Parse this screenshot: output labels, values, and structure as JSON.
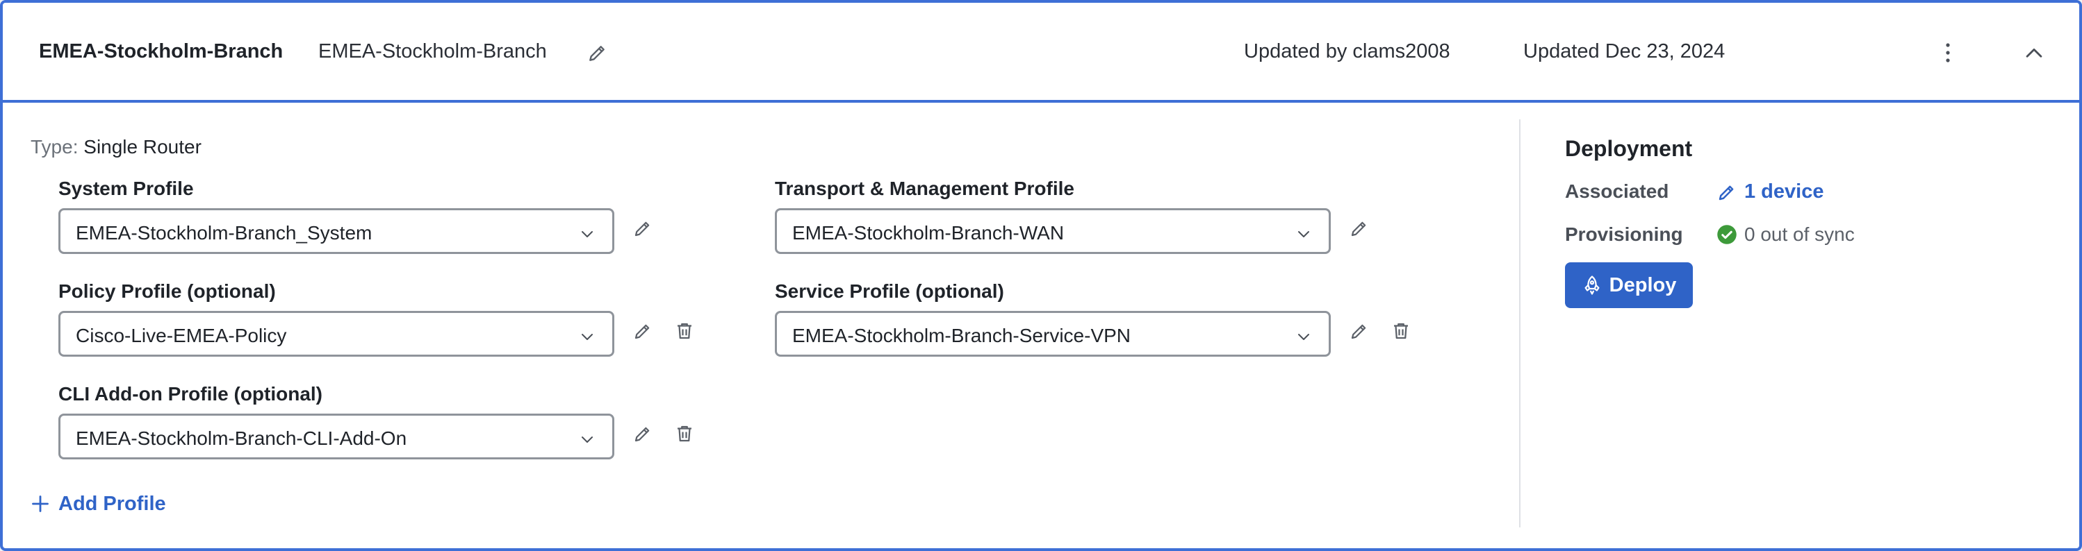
{
  "header": {
    "name": "EMEA-Stockholm-Branch",
    "description": "EMEA-Stockholm-Branch",
    "updated_by": "Updated by clams2008",
    "updated_date": "Updated Dec 23, 2024"
  },
  "type": {
    "key": "Type:",
    "value": "Single Router"
  },
  "profiles": {
    "system": {
      "label": "System Profile",
      "value": "EMEA-Stockholm-Branch_System"
    },
    "transport": {
      "label": "Transport & Management Profile",
      "value": "EMEA-Stockholm-Branch-WAN"
    },
    "policy": {
      "label": "Policy Profile (optional)",
      "value": "Cisco-Live-EMEA-Policy"
    },
    "service": {
      "label": "Service Profile (optional)",
      "value": "EMEA-Stockholm-Branch-Service-VPN"
    },
    "cli": {
      "label": "CLI Add-on Profile (optional)",
      "value": "EMEA-Stockholm-Branch-CLI-Add-On"
    }
  },
  "add_profile_label": "Add Profile",
  "deployment": {
    "title": "Deployment",
    "associated_label": "Associated",
    "associated_value": "1 device",
    "provisioning_label": "Provisioning",
    "provisioning_value": "0 out of sync",
    "deploy_label": "Deploy"
  },
  "colors": {
    "accent": "#2f63c7",
    "card_border": "#3e6fd6",
    "status_ok": "#3d9a3a"
  },
  "icons": {
    "edit": "pencil-icon",
    "delete": "trash-icon",
    "more": "kebab-icon",
    "collapse": "chevron-up-icon",
    "dropdown": "chevron-down-icon",
    "add": "plus-icon",
    "link": "pencil-icon",
    "status": "check-circle-icon",
    "deploy": "rocket-icon"
  }
}
